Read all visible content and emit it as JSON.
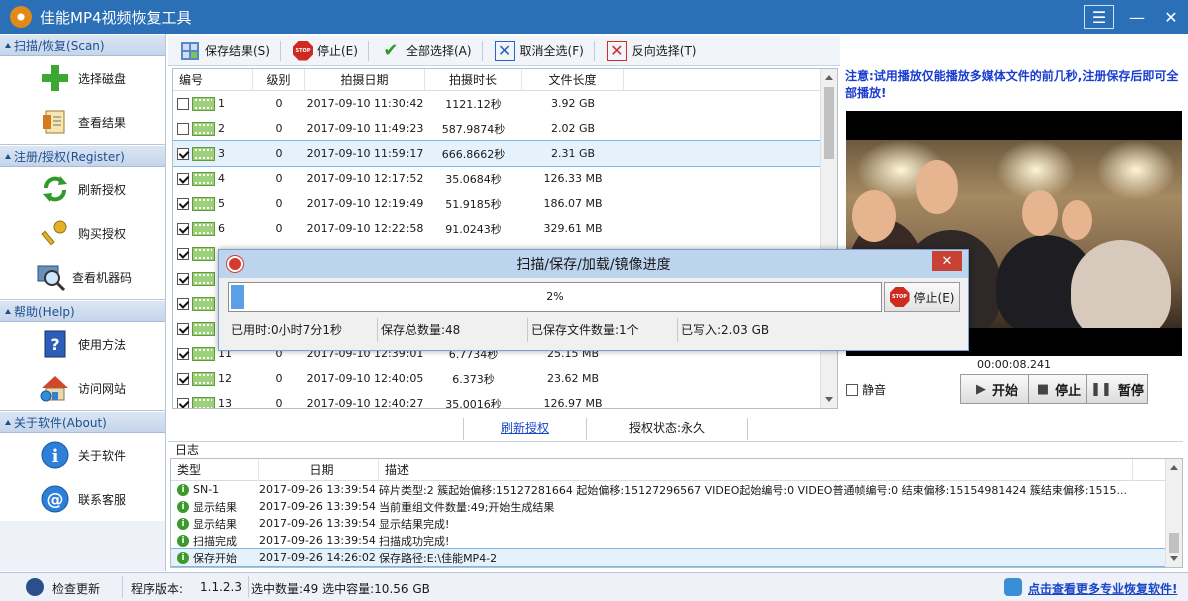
{
  "window": {
    "title": "佳能MP4视频恢复工具"
  },
  "sidebar": {
    "sections": [
      {
        "header": "扫描/恢复(Scan)",
        "items": [
          {
            "label": "选择磁盘",
            "icon": "plus-icon"
          },
          {
            "label": "查看结果",
            "icon": "document-icon"
          }
        ]
      },
      {
        "header": "注册/授权(Register)",
        "items": [
          {
            "label": "刷新授权",
            "icon": "refresh-icon"
          },
          {
            "label": "购买授权",
            "icon": "key-icon"
          },
          {
            "label": "查看机器码",
            "icon": "magnifier-icon"
          }
        ]
      },
      {
        "header": "帮助(Help)",
        "items": [
          {
            "label": "使用方法",
            "icon": "help-book-icon"
          },
          {
            "label": "访问网站",
            "icon": "home-icon"
          }
        ]
      },
      {
        "header": "关于软件(About)",
        "items": [
          {
            "label": "关于软件",
            "icon": "info-icon"
          },
          {
            "label": "联系客服",
            "icon": "at-sign-icon"
          }
        ]
      }
    ]
  },
  "toolbar": {
    "save": "保存结果(S)",
    "stop": "停止(E)",
    "select_all": "全部选择(A)",
    "deselect_all": "取消全选(F)",
    "invert": "反向选择(T)"
  },
  "table": {
    "columns": [
      "编号",
      "级别",
      "拍摄日期",
      "拍摄时长",
      "文件长度"
    ],
    "rows": [
      {
        "checked": false,
        "id": "1",
        "level": "0",
        "date": "2017-09-10 11:30:42",
        "duration": "1121.12秒",
        "size": "3.92 GB"
      },
      {
        "checked": false,
        "id": "2",
        "level": "0",
        "date": "2017-09-10 11:49:23",
        "duration": "587.9874秒",
        "size": "2.02 GB"
      },
      {
        "checked": true,
        "id": "3",
        "level": "0",
        "date": "2017-09-10 11:59:17",
        "duration": "666.8662秒",
        "size": "2.31 GB"
      },
      {
        "checked": true,
        "id": "4",
        "level": "0",
        "date": "2017-09-10 12:17:52",
        "duration": "35.0684秒",
        "size": "126.33 MB"
      },
      {
        "checked": true,
        "id": "5",
        "level": "0",
        "date": "2017-09-10 12:19:49",
        "duration": "51.9185秒",
        "size": "186.07 MB"
      },
      {
        "checked": true,
        "id": "6",
        "level": "0",
        "date": "2017-09-10 12:22:58",
        "duration": "91.0243秒",
        "size": "329.61 MB"
      },
      {
        "checked": true,
        "id": "",
        "level": "",
        "date": "",
        "duration": "",
        "size": ""
      },
      {
        "checked": true,
        "id": "",
        "level": "",
        "date": "",
        "duration": "",
        "size": ""
      },
      {
        "checked": true,
        "id": "",
        "level": "",
        "date": "",
        "duration": "",
        "size": ""
      },
      {
        "checked": true,
        "id": "",
        "level": "",
        "date": "",
        "duration": "",
        "size": ""
      },
      {
        "checked": true,
        "id": "11",
        "level": "0",
        "date": "2017-09-10 12:39:01",
        "duration": "6.7734秒",
        "size": "25.15 MB"
      },
      {
        "checked": true,
        "id": "12",
        "level": "0",
        "date": "2017-09-10 12:40:05",
        "duration": "6.373秒",
        "size": "23.62 MB"
      },
      {
        "checked": true,
        "id": "13",
        "level": "0",
        "date": "2017-09-10 12:40:27",
        "duration": "35.0016秒",
        "size": "126.97 MB"
      }
    ],
    "selected_index": 2
  },
  "preview": {
    "notice": "注意:试用播放仅能播放多媒体文件的前几秒,注册保存后即可全部播放!",
    "timecode": "00:00:08.241",
    "mute": "静音",
    "play": "开始",
    "stop": "停止",
    "pause": "暂停"
  },
  "mid": {
    "refresh_link": "刷新授权",
    "license_status": "授权状态:永久"
  },
  "log": {
    "label": "日志",
    "columns": [
      "类型",
      "日期",
      "描述"
    ],
    "rows": [
      {
        "type": "SN-1",
        "date": "2017-09-26 13:39:54",
        "desc": "碎片类型:2 簇起始偏移:15127281664 起始偏移:15127296567 VIDEO起始编号:0 VIDEO普通帧编号:0 结束偏移:15154981424 簇结束偏移:1515..."
      },
      {
        "type": "显示结果",
        "date": "2017-09-26 13:39:54",
        "desc": "当前重组文件数量:49;开始生成结果"
      },
      {
        "type": "显示结果",
        "date": "2017-09-26 13:39:54",
        "desc": "显示结果完成!"
      },
      {
        "type": "扫描完成",
        "date": "2017-09-26 13:39:54",
        "desc": "扫描成功完成!"
      },
      {
        "type": "保存开始",
        "date": "2017-09-26 14:26:02",
        "desc": "保存路径:E:\\佳能MP4-2"
      }
    ]
  },
  "status": {
    "check_update": "检查更新",
    "version_label": "程序版本:",
    "version": "1.1.2.3",
    "selection": "选中数量:49 选中容量:10.56 GB",
    "promo": "点击查看更多专业恢复软件!"
  },
  "dialog": {
    "title": "扫描/保存/加载/镜像进度",
    "percent": "2%",
    "progress": 0.02,
    "stop": "停止(E)",
    "elapsed": "已用时:0小时7分1秒",
    "total": "保存总数量:48",
    "saved": "已保存文件数量:1个",
    "written": "已写入:2.03 GB"
  },
  "colors": {
    "titlebar": "#2b6fb6",
    "notice": "#1a3dd0",
    "accent": "#5aa0e6"
  }
}
